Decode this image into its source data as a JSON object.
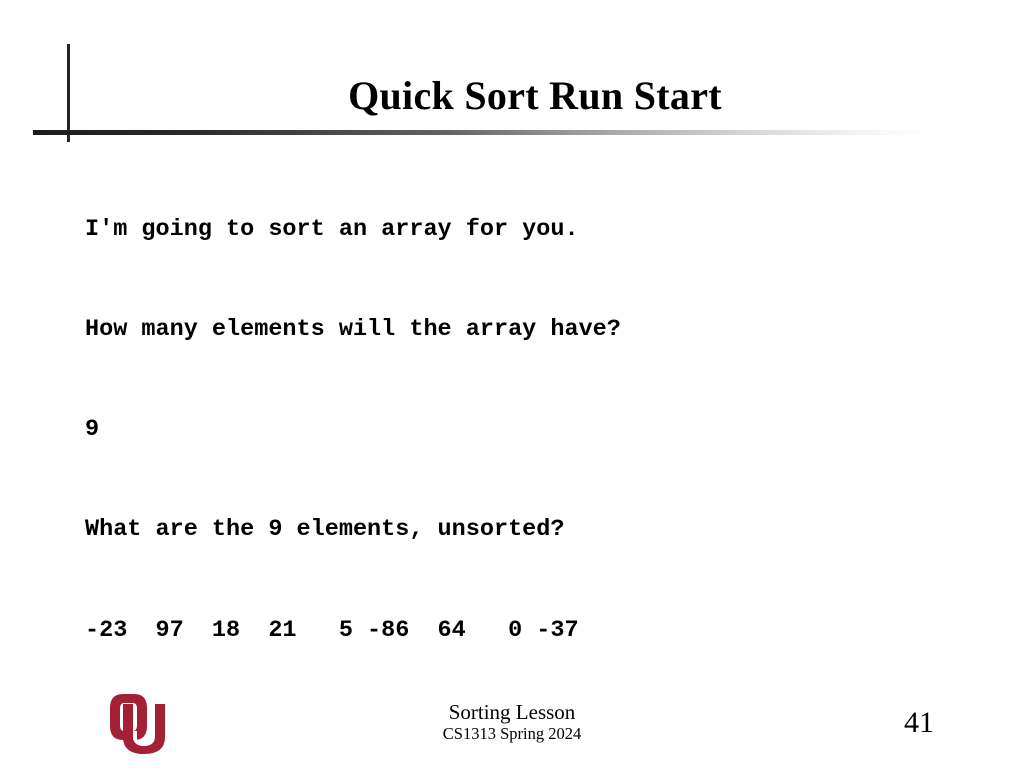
{
  "slide": {
    "title": "Quick Sort Run Start",
    "body_lines": [
      "I'm going to sort an array for you.",
      "How many elements will the array have?",
      "9",
      "What are the 9 elements, unsorted?",
      "-23  97  18  21   5 -86  64   0 -37"
    ],
    "program_output": {
      "prompt_intro": "I'm going to sort an array for you.",
      "prompt_count": "How many elements will the array have?",
      "entered_count": "9",
      "prompt_values": "What are the 9 elements, unsorted?",
      "array_values": [
        -23,
        97,
        18,
        21,
        5,
        -86,
        64,
        0,
        -37
      ],
      "element_count": 9
    }
  },
  "footer": {
    "lesson": "Sorting Lesson",
    "course": "CS1313 Spring 2024",
    "page_number": "41",
    "logo_name": "ou-logo",
    "logo_color": "#A32035"
  },
  "colors": {
    "text": "#000000",
    "rule_dark": "#1c1c1c",
    "background": "#ffffff",
    "crimson": "#A32035"
  }
}
